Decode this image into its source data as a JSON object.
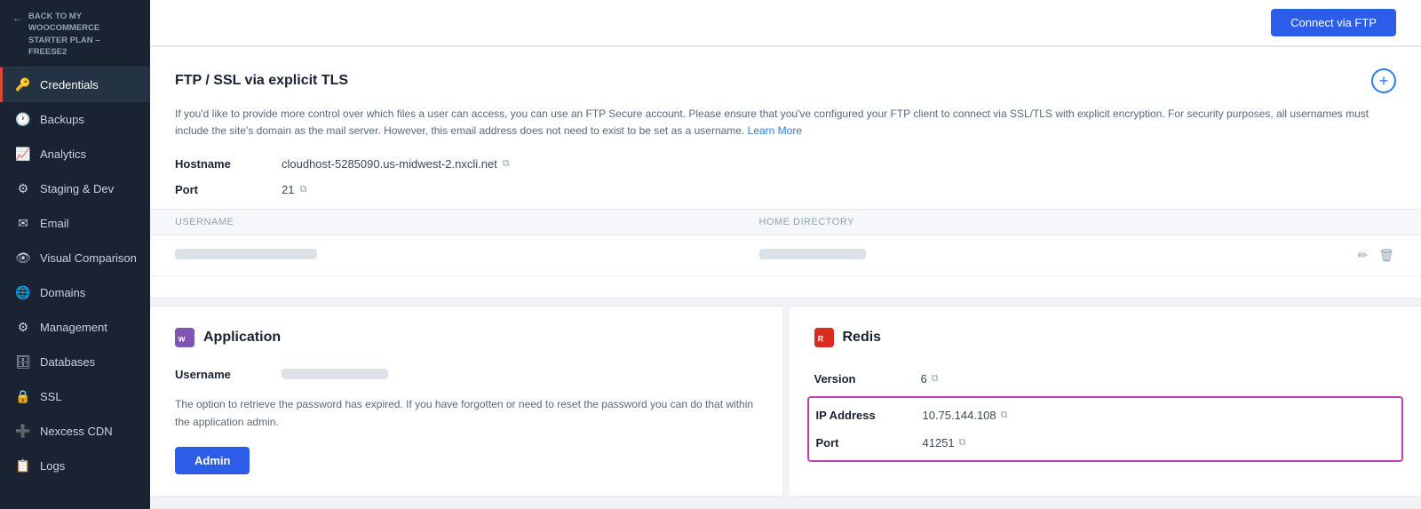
{
  "sidebar": {
    "back_label": "BACK TO MY WOOCOMMERCE STARTER PLAN – FREESE2",
    "items": [
      {
        "id": "credentials",
        "label": "Credentials",
        "icon": "🔑",
        "active": true
      },
      {
        "id": "backups",
        "label": "Backups",
        "icon": "🕐"
      },
      {
        "id": "analytics",
        "label": "Analytics",
        "icon": "📈"
      },
      {
        "id": "staging",
        "label": "Staging & Dev",
        "icon": "⚙"
      },
      {
        "id": "email",
        "label": "Email",
        "icon": "✉"
      },
      {
        "id": "visual",
        "label": "Visual Comparison",
        "icon": "👁"
      },
      {
        "id": "domains",
        "label": "Domains",
        "icon": "🌐"
      },
      {
        "id": "management",
        "label": "Management",
        "icon": "⚙"
      },
      {
        "id": "databases",
        "label": "Databases",
        "icon": "🗄"
      },
      {
        "id": "ssl",
        "label": "SSL",
        "icon": "🔒"
      },
      {
        "id": "nexcess",
        "label": "Nexcess CDN",
        "icon": "+"
      },
      {
        "id": "logs",
        "label": "Logs",
        "icon": "📋"
      }
    ]
  },
  "top_button_label": "Connect via FTP",
  "ftp_section": {
    "title": "FTP / SSL via explicit TLS",
    "description": "If you'd like to provide more control over which files a user can access, you can use an FTP Secure account. Please ensure that you've configured your FTP client to connect via SSL/TLS with explicit encryption. For security purposes, all usernames must include the site's domain as the mail server. However, this email address does not need to exist to be set as a username.",
    "learn_more_label": "Learn More",
    "hostname_label": "Hostname",
    "hostname_value": "cloudhost-5285090.us-midwest-2.nxcli.net",
    "port_label": "Port",
    "port_value": "21",
    "table": {
      "col_username": "Username",
      "col_homedir": "Home Directory"
    }
  },
  "application_section": {
    "title": "Application",
    "username_label": "Username",
    "description": "The option to retrieve the password has expired. If you have forgotten or need to reset the password you can do that within the application admin.",
    "admin_button_label": "Admin"
  },
  "redis_section": {
    "title": "Redis",
    "version_label": "Version",
    "version_value": "6",
    "ip_label": "IP Address",
    "ip_value": "10.75.144.108",
    "port_label": "Port",
    "port_value": "41251"
  }
}
